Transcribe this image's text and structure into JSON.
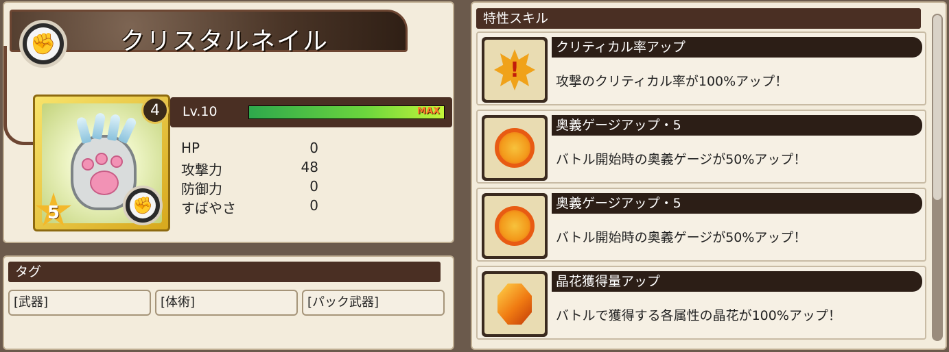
{
  "weapon": {
    "name": "クリスタルネイル",
    "type_icon": "fist-icon",
    "rarity_number": "4",
    "star": "5"
  },
  "level": {
    "label": "Lv.10",
    "max_label": "MAX",
    "progress": 1.0
  },
  "stats": [
    {
      "label": "HP",
      "value": "0"
    },
    {
      "label": "攻撃力",
      "value": "48"
    },
    {
      "label": "防御力",
      "value": "0"
    },
    {
      "label": "すばやさ",
      "value": "0"
    }
  ],
  "tags": {
    "header": "タグ",
    "items": [
      "[武器]",
      "[体術]",
      "[パック武器]"
    ]
  },
  "skills": {
    "header": "特性スキル",
    "items": [
      {
        "title": "クリティカル率アップ",
        "desc": "攻撃のクリティカル率が100%アップ！",
        "icon": "critical-burst-icon"
      },
      {
        "title": "奥義ゲージアップ・5",
        "desc": "バトル開始時の奥義ゲージが50%アップ！",
        "icon": "gauge-wheel-icon"
      },
      {
        "title": "奥義ゲージアップ・5",
        "desc": "バトル開始時の奥義ゲージが50%アップ！",
        "icon": "gauge-wheel-icon"
      },
      {
        "title": "晶花獲得量アップ",
        "desc": "バトルで獲得する各属性の晶花が100%アップ！",
        "icon": "crystal-gem-icon"
      }
    ]
  },
  "colors": {
    "panel_bg": "#f3ecdc",
    "header_bg": "#4a2f23",
    "gauge_green": "#6cd63d",
    "max_orange": "#ff7b2c"
  }
}
